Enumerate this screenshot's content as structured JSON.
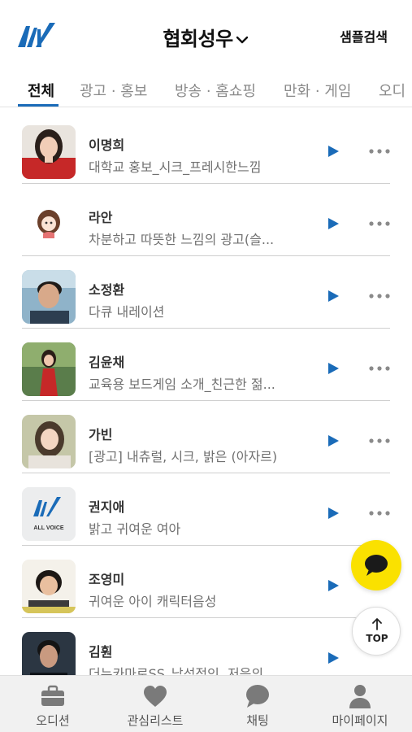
{
  "header": {
    "title": "협회성우",
    "sample_search": "샘플검색"
  },
  "colors": {
    "accent": "#1a6bb8",
    "kakao": "#fae100",
    "nav_bg": "#f1f1f1"
  },
  "tabs": [
    {
      "label": "전체",
      "active": true
    },
    {
      "label": "광고 · 홍보",
      "active": false
    },
    {
      "label": "방송 · 홈쇼핑",
      "active": false
    },
    {
      "label": "만화 · 게임",
      "active": false
    },
    {
      "label": "오디",
      "active": false
    }
  ],
  "voices": [
    {
      "name": "이명희",
      "desc": "대학교 홍보_시크_프레시한느낌",
      "avatar": "woman-red-dress"
    },
    {
      "name": "라안",
      "desc": "차분하고 따뜻한 느낌의 광고(슬...",
      "avatar": "cartoon-girl"
    },
    {
      "name": "소정환",
      "desc": "다큐 내레이션",
      "avatar": "man-headshot"
    },
    {
      "name": "김윤채",
      "desc": "교육용 보드게임 소개_친근한 젊...",
      "avatar": "woman-red-outdoor"
    },
    {
      "name": "가빈",
      "desc": "[광고] 내츄럴, 시크, 밝은 (아자르)",
      "avatar": "woman-portrait"
    },
    {
      "name": "권지애",
      "desc": "밝고 귀여운 여아",
      "avatar": "all-voice-logo"
    },
    {
      "name": "조영미",
      "desc": "귀여운 아이 캐릭터음성",
      "avatar": "woman-short-hair"
    },
    {
      "name": "김훤",
      "desc": "더뉴카마로SS_남성적인, 저음의...",
      "avatar": "man-dark"
    }
  ],
  "logo_tile_text": "ALL VOICE",
  "floating": {
    "top_label": "TOP"
  },
  "bottom_nav": [
    {
      "label": "오디션",
      "icon": "briefcase-icon"
    },
    {
      "label": "관심리스트",
      "icon": "heart-icon"
    },
    {
      "label": "채팅",
      "icon": "chat-bubble-icon"
    },
    {
      "label": "마이페이지",
      "icon": "person-icon"
    }
  ]
}
